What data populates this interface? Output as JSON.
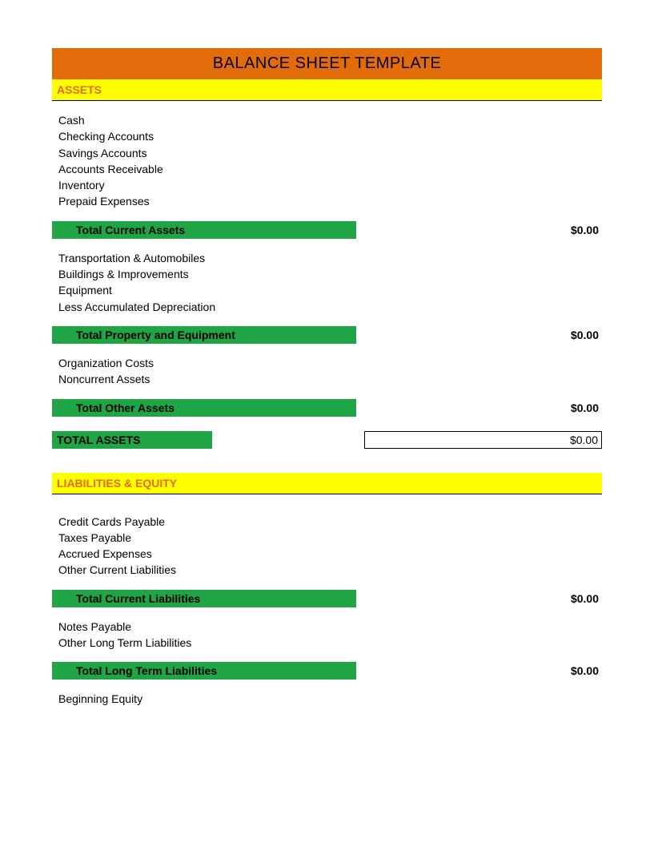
{
  "title": "BALANCE SHEET TEMPLATE",
  "sections": {
    "assets": {
      "header": "ASSETS",
      "current_assets": {
        "items": [
          "Cash",
          "Checking Accounts",
          "Savings Accounts",
          "Accounts Receivable",
          "Inventory",
          "Prepaid Expenses"
        ],
        "subtotal_label": "Total Current Assets",
        "subtotal_value": "$0.00"
      },
      "property_equipment": {
        "items": [
          "Transportation & Automobiles",
          "Buildings & Improvements",
          "Equipment",
          "Less Accumulated Depreciation"
        ],
        "subtotal_label": "Total Property and Equipment",
        "subtotal_value": "$0.00"
      },
      "other_assets": {
        "items": [
          "Organization Costs",
          "Noncurrent Assets"
        ],
        "subtotal_label": "Total Other Assets",
        "subtotal_value": "$0.00"
      },
      "total_label": "TOTAL ASSETS",
      "total_value": "$0.00"
    },
    "liabilities_equity": {
      "header": "LIABILITIES & EQUITY",
      "current_liabilities": {
        "items": [
          "Credit Cards Payable",
          "Taxes Payable",
          "Accrued Expenses",
          "Other Current Liabilities"
        ],
        "subtotal_label": "Total Current Liabilities",
        "subtotal_value": "$0.00"
      },
      "long_term_liabilities": {
        "items": [
          "Notes Payable",
          "Other Long Term Liabilities"
        ],
        "subtotal_label": "Total Long Term Liabilities",
        "subtotal_value": "$0.00"
      },
      "equity": {
        "items": [
          "Beginning Equity"
        ]
      }
    }
  },
  "colors": {
    "title_bg": "#e36c0a",
    "section_bg": "#ffff00",
    "section_text": "#e36c0a",
    "subtotal_bg": "#1fa546"
  }
}
